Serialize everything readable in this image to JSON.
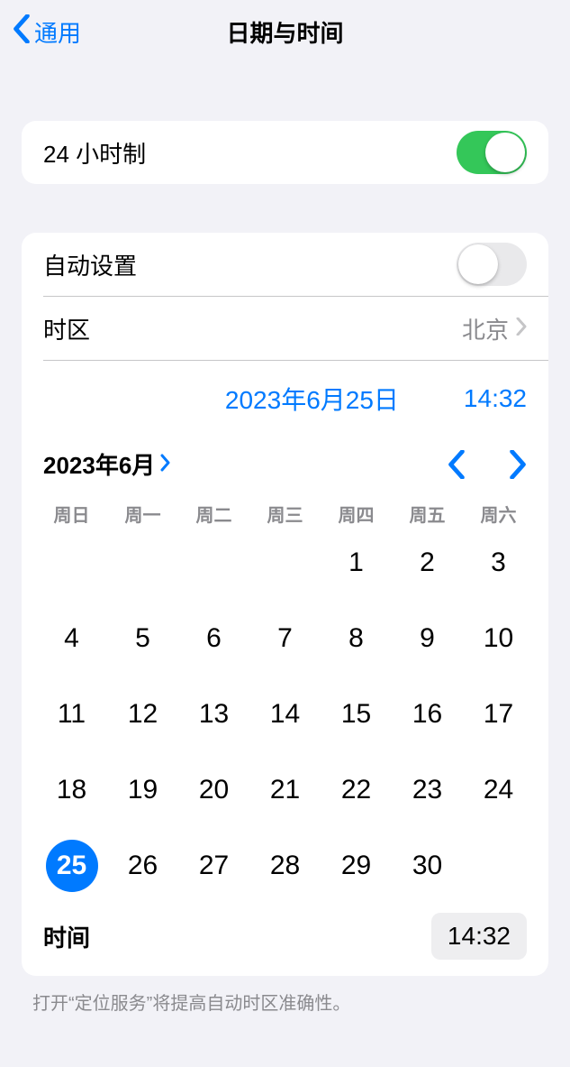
{
  "header": {
    "back_label": "通用",
    "title": "日期与时间"
  },
  "items": {
    "twenty_four_hour_label": "24 小时制",
    "auto_set_label": "自动设置",
    "timezone_label": "时区",
    "timezone_value": "北京"
  },
  "switches": {
    "twenty_four_hour_on": true,
    "auto_set_on": false
  },
  "picker": {
    "date_text": "2023年6月25日",
    "time_text": "14:32"
  },
  "calendar": {
    "month_label": "2023年6月",
    "weekdays": [
      "周日",
      "周一",
      "周二",
      "周三",
      "周四",
      "周五",
      "周六"
    ],
    "leading_blanks": 4,
    "days_in_month": 30,
    "selected_day": 25
  },
  "time_row": {
    "label": "时间",
    "value": "14:32"
  },
  "footer": {
    "note": "打开“定位服务”将提高自动时区准确性。"
  },
  "colors": {
    "accent": "#007aff",
    "switch_on": "#34c759",
    "bg": "#f2f2f7"
  }
}
